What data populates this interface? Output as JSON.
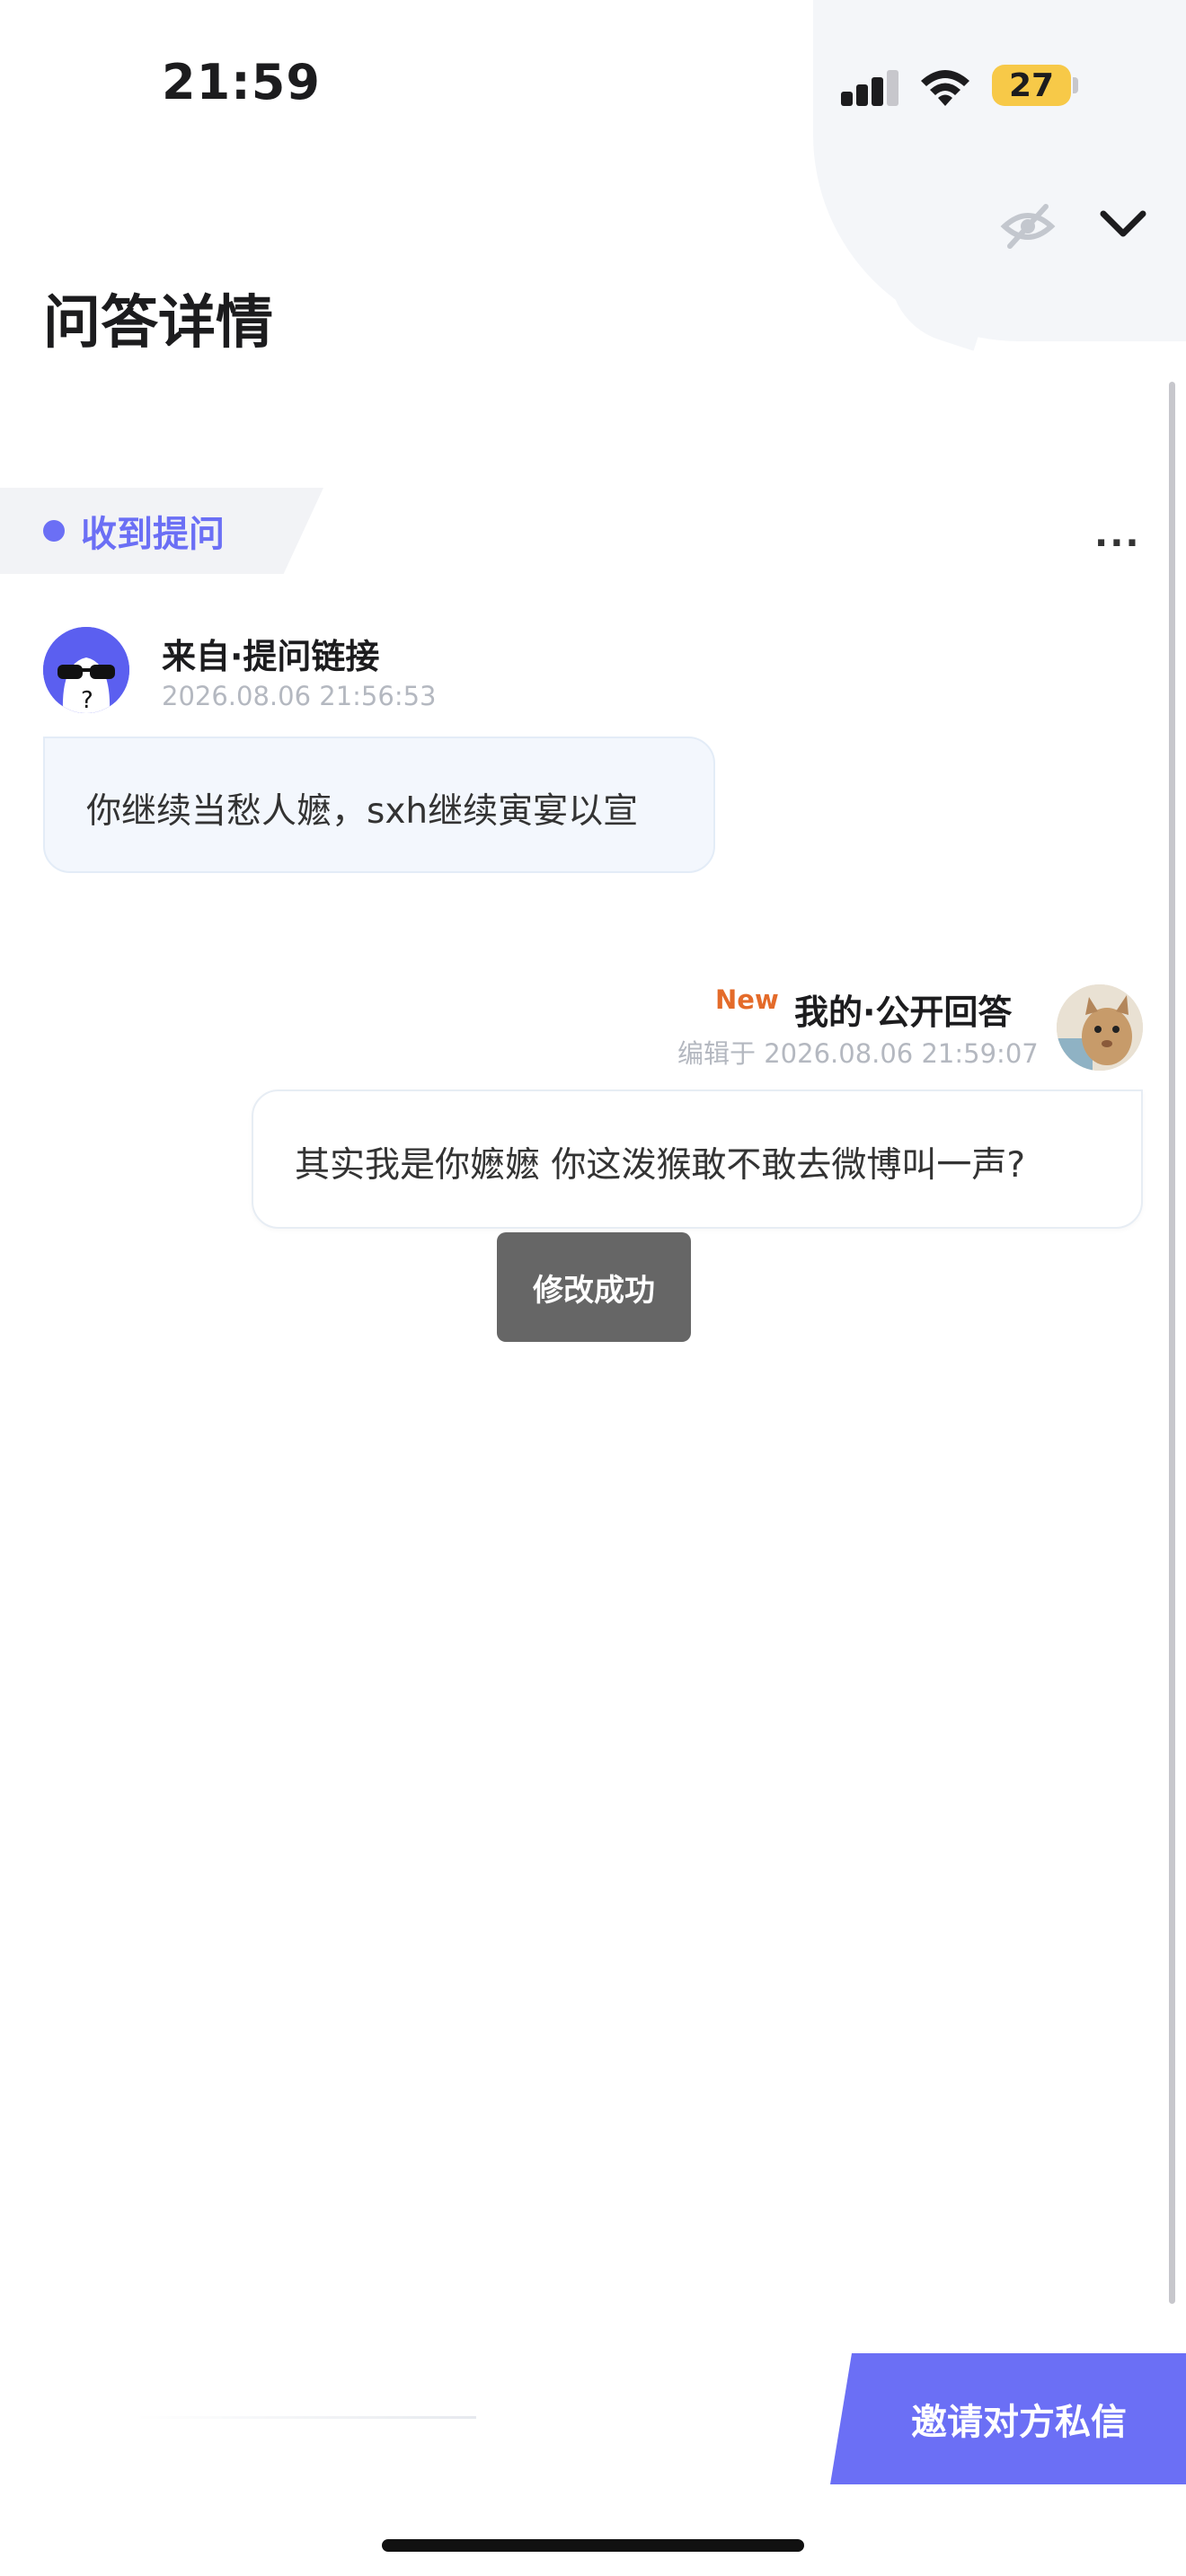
{
  "status_bar": {
    "time": "21:59",
    "battery": "27"
  },
  "header": {
    "title": "问答详情"
  },
  "section": {
    "tag_label": "收到提问",
    "more_label": "..."
  },
  "question": {
    "source": "来自·提问链接",
    "time": "2026.08.06 21:56:53",
    "text": "你继续当愁人嬷，sxh继续寅宴以宣"
  },
  "answer": {
    "badge": "New",
    "source": "我的·公开回答",
    "edited": "编辑于 2026.08.06 21:59:07",
    "text": "其实我是你嬷嬷 你这泼猴敢不敢去微博叫一声?"
  },
  "toast": {
    "text": "修改成功"
  },
  "footer": {
    "invite_label": "邀请对方私信"
  },
  "colors": {
    "accent": "#6b6ff5",
    "new_badge": "#e46b2a",
    "toast_bg": "#666666",
    "battery": "#f7c948"
  },
  "icons": {
    "visibility": "eye-off-icon",
    "collapse": "chevron-down-icon",
    "more": "more-dots-icon"
  }
}
